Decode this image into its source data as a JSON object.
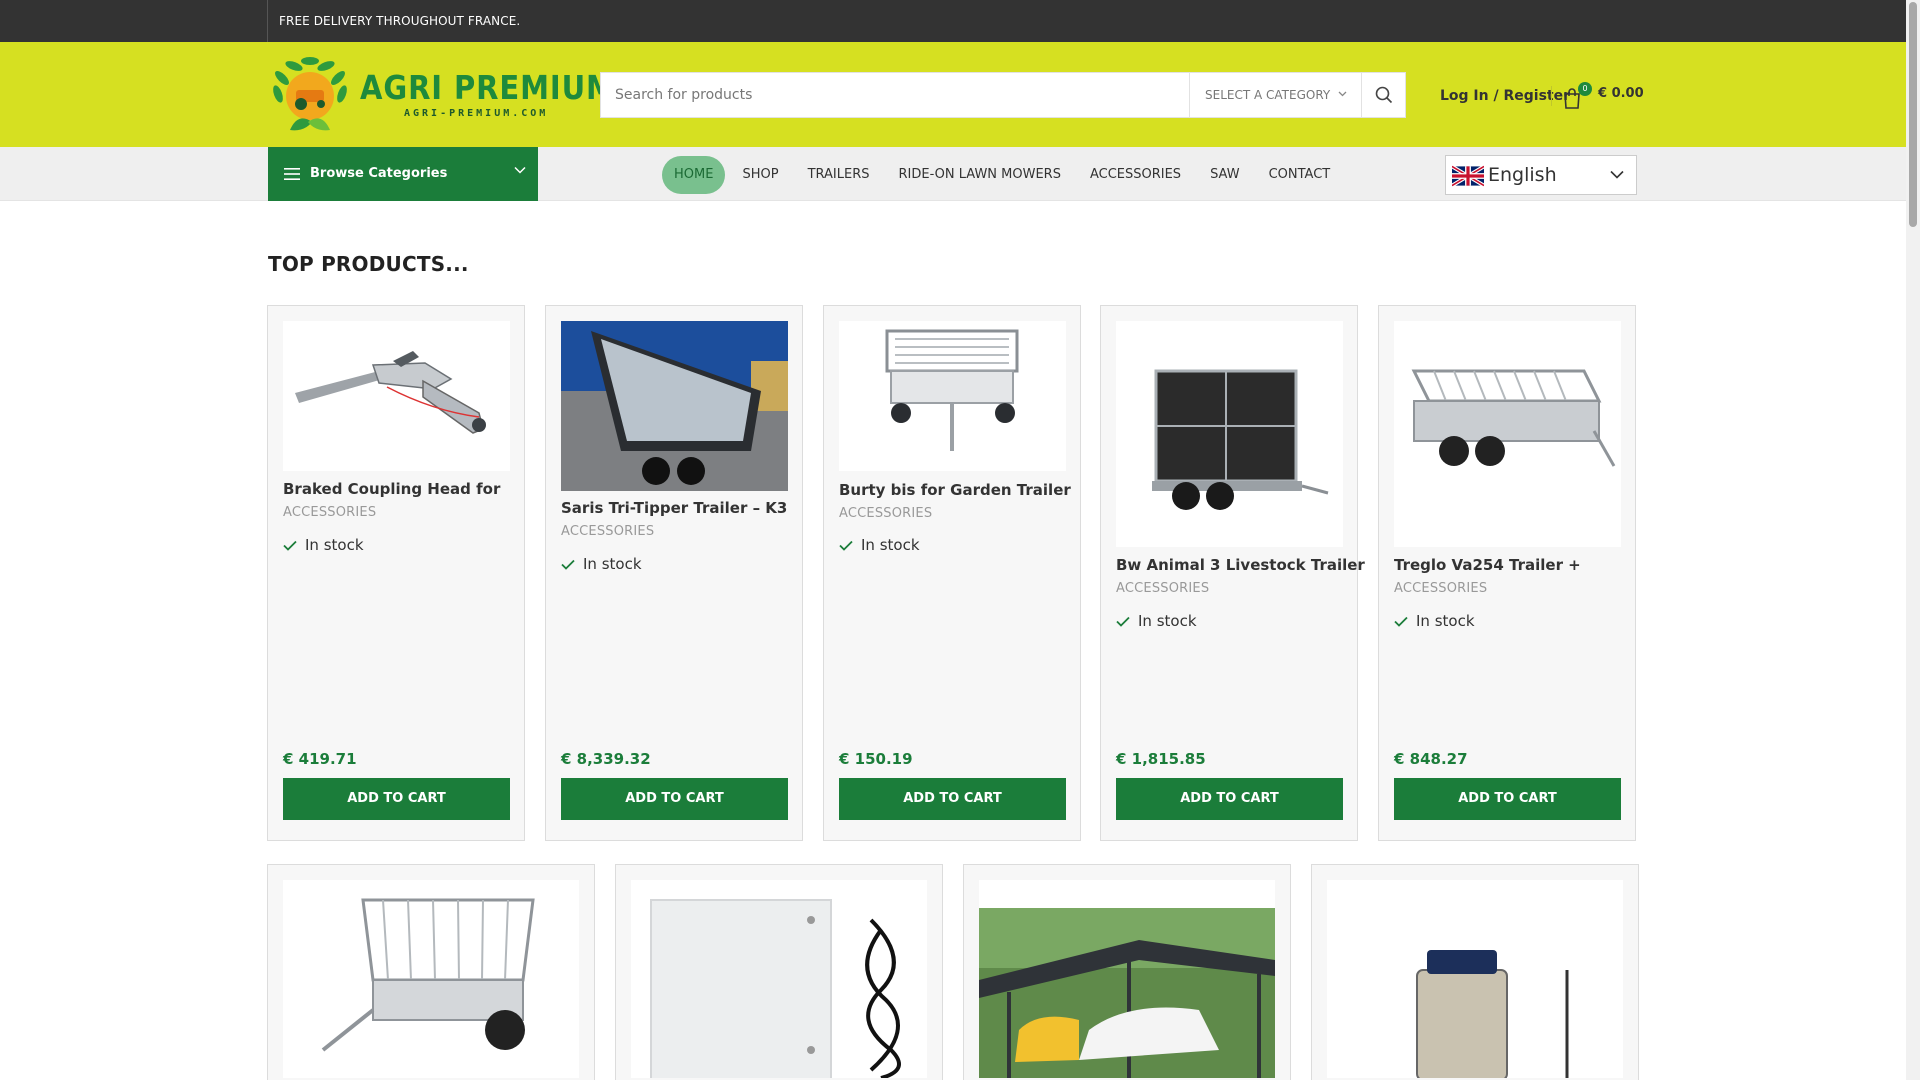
{
  "topbar": {
    "promo": "FREE DELIVERY THROUGHOUT FRANCE."
  },
  "header": {
    "logo_title": "AGRI PREMIUM",
    "logo_sub": "AGRI-PREMIUM.COM",
    "search_placeholder": "Search for products",
    "category_select": "SELECT A CATEGORY",
    "login": "Log In / Register",
    "cart_count": "0",
    "cart_total": "€ 0.00"
  },
  "nav": {
    "browse": "Browse Categories",
    "items": [
      "HOME",
      "SHOP",
      "TRAILERS",
      "RIDE-ON LAWN MOWERS",
      "ACCESSORIES",
      "SAW",
      "CONTACT"
    ],
    "active": "HOME",
    "language": "English"
  },
  "section_title": "TOP PRODUCTS...",
  "products": [
    {
      "name": "Braked Coupling Head for",
      "category": "ACCESSORIES",
      "stock": "In stock",
      "price": "€ 419.71",
      "cta": "ADD TO CART"
    },
    {
      "name": "Saris Tri-Tipper Trailer – K3",
      "category": "ACCESSORIES",
      "stock": "In stock",
      "price": "€ 8,339.32",
      "cta": "ADD TO CART"
    },
    {
      "name": "Burty bis for Garden Trailer",
      "category": "ACCESSORIES",
      "stock": "In stock",
      "price": "€ 150.19",
      "cta": "ADD TO CART"
    },
    {
      "name": "Bw Animal 3 Livestock Trailer",
      "category": "ACCESSORIES",
      "stock": "In stock",
      "price": "€ 1,815.85",
      "cta": "ADD TO CART"
    },
    {
      "name": "Treglo Va254 Trailer +",
      "category": "ACCESSORIES",
      "stock": "In stock",
      "price": "€ 848.27",
      "cta": "ADD TO CART"
    }
  ],
  "colors": {
    "header_bg": "#d6e021",
    "brand_green": "#1b7d3a",
    "topbar_bg": "#333333"
  },
  "icons": [
    "search-icon",
    "cart-icon",
    "hamburger-icon",
    "chevron-down-icon",
    "check-icon",
    "uk-flag-icon"
  ]
}
